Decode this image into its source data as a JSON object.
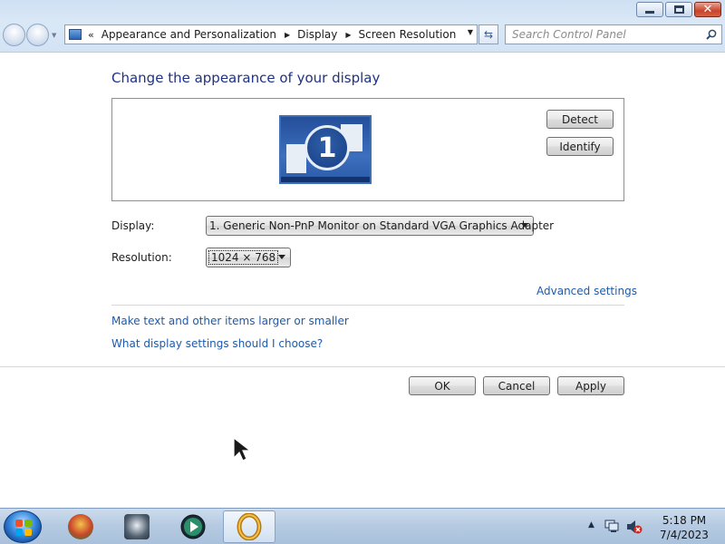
{
  "window": {
    "title": "Screen Resolution",
    "caption_buttons": [
      "minimize",
      "restore",
      "close"
    ]
  },
  "nav": {
    "breadcrumbs": [
      "Appearance and Personalization",
      "Display",
      "Screen Resolution"
    ],
    "search_placeholder": "Search Control Panel"
  },
  "main": {
    "title": "Change the appearance of your display",
    "monitor_number": "1",
    "detect_label": "Detect",
    "identify_label": "Identify",
    "display_label": "Display:",
    "display_value": "1. Generic Non-PnP Monitor on Standard VGA Graphics Adapter",
    "resolution_label": "Resolution:",
    "resolution_value": "1024 × 768",
    "advanced_link": "Advanced settings",
    "larger_link": "Make text and other items larger or smaller",
    "whatdisplay_link": "What display settings should I choose?"
  },
  "footer": {
    "ok_label": "OK",
    "cancel_label": "Cancel",
    "apply_label": "Apply"
  },
  "taskbar": {
    "apps": [
      {
        "icon": "app-icon-1"
      },
      {
        "icon": "app-icon-2"
      },
      {
        "icon": "media-player-icon"
      },
      {
        "icon": "ring-icon",
        "active": true
      }
    ],
    "clock_time": "5:18 PM",
    "clock_date": "7/4/2023"
  },
  "colors": {
    "accent_title": "#1e3287",
    "link": "#1e5aa8",
    "nav_bg": "#d3e3f4"
  }
}
